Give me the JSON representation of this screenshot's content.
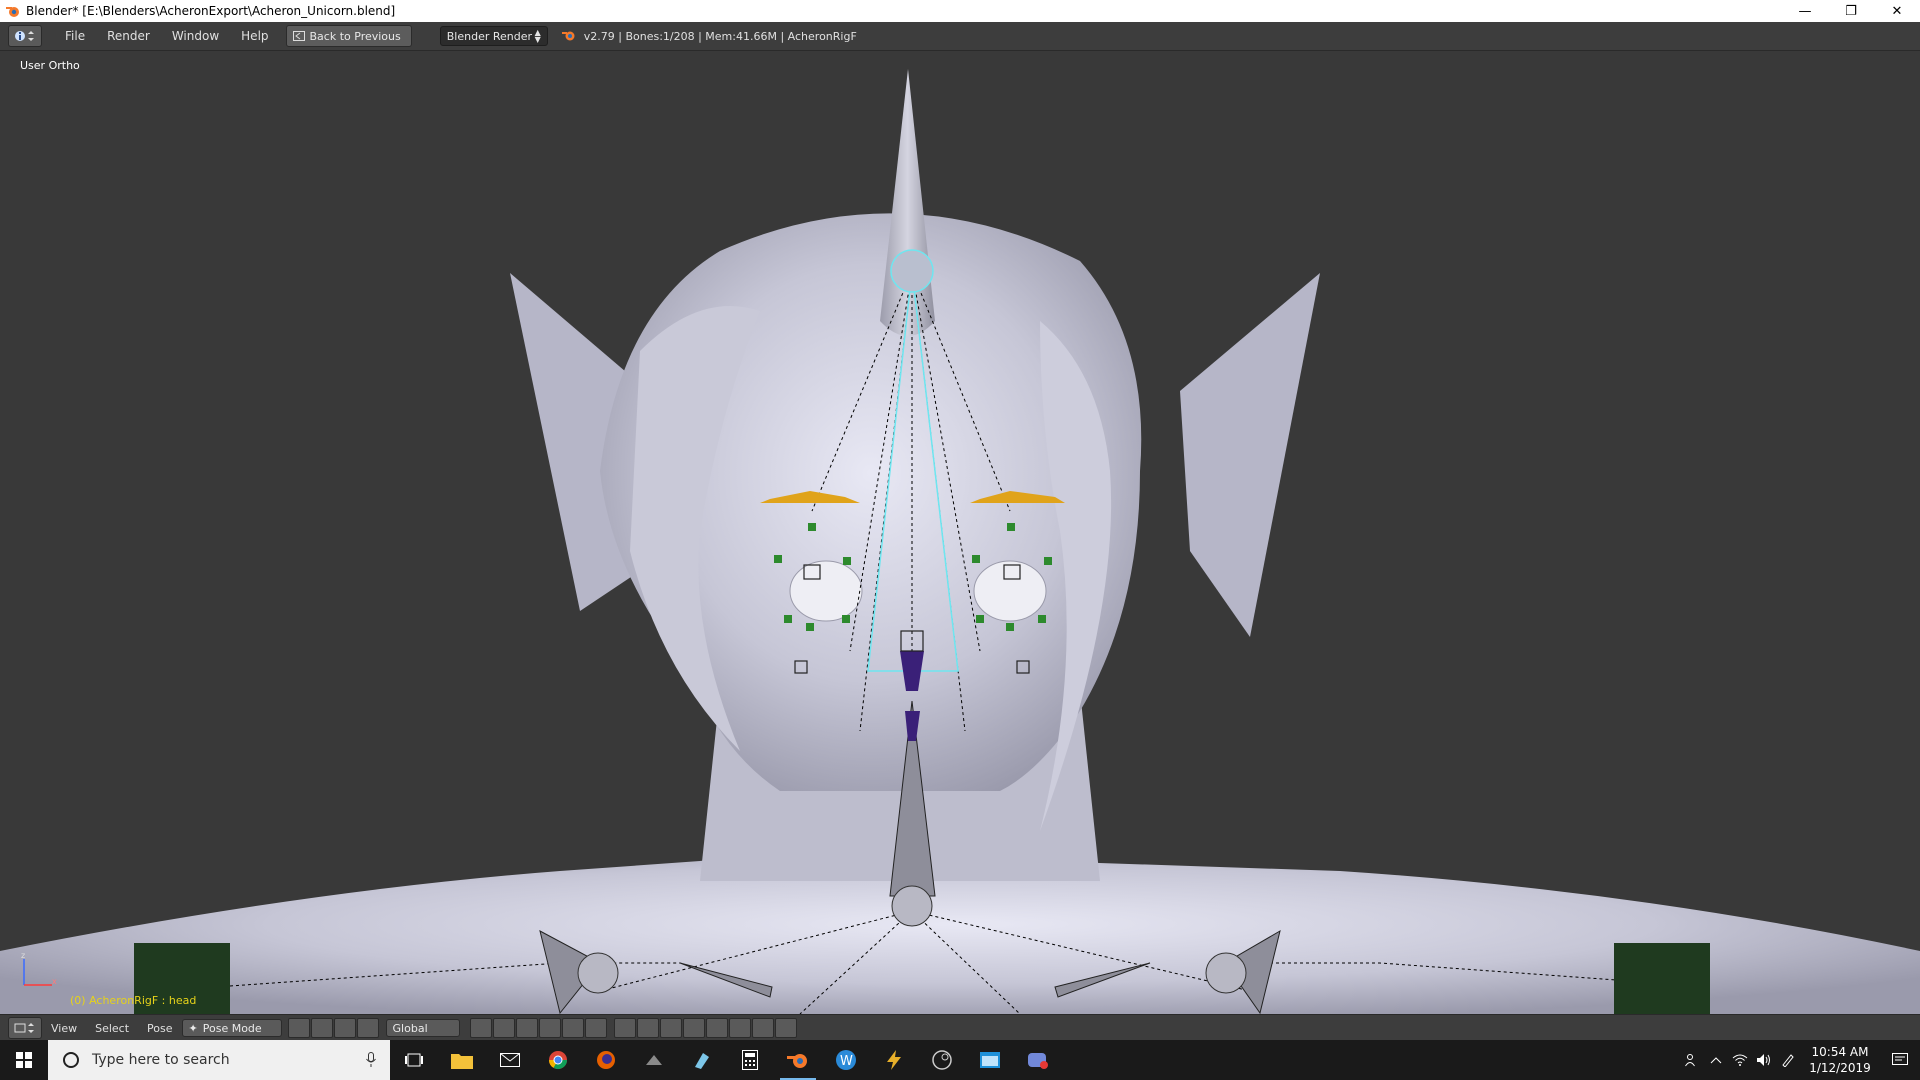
{
  "window": {
    "title": "Blender* [E:\\Blenders\\AcheronExport\\Acheron_Unicorn.blend]"
  },
  "info_header": {
    "menus": [
      "File",
      "Render",
      "Window",
      "Help"
    ],
    "back_button": "Back to Previous",
    "render_engine": "Blender Render",
    "stats": "v2.79 | Bones:1/208 | Mem:41.66M | AcheronRigF"
  },
  "viewport": {
    "view_label": "User Ortho",
    "object_label": "(0) AcheronRigF : head"
  },
  "view3d_header": {
    "menus": [
      "View",
      "Select",
      "Pose"
    ],
    "mode": "Pose Mode",
    "orientation": "Global"
  },
  "taskbar": {
    "search_placeholder": "Type here to search",
    "time": "10:54 AM",
    "date": "1/12/2019"
  }
}
